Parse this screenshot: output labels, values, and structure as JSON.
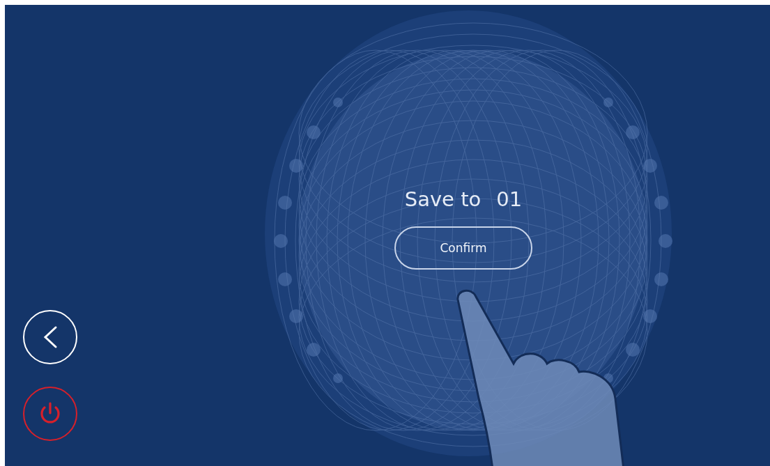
{
  "prompt": {
    "label": "Save to",
    "slot": "01"
  },
  "confirm_button": {
    "label": "Confirm"
  },
  "nav": [
    {
      "kind": "back"
    },
    {
      "kind": "power"
    }
  ]
}
